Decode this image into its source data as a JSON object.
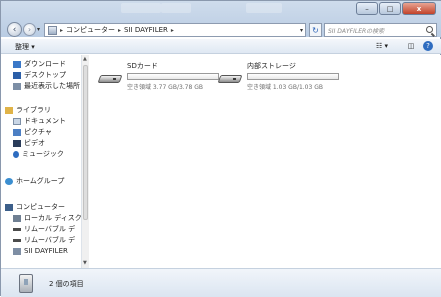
{
  "window": {
    "close_glyph": "x",
    "maximize_glyph": "□",
    "minimize_glyph": "–"
  },
  "address": {
    "crumbs": [
      "コンピューター",
      "SII DAYFILER"
    ],
    "separator": "▸",
    "dropdown": "▾"
  },
  "search": {
    "placeholder": "SII DAYFILERの検索"
  },
  "toolbar": {
    "organize_label": "整理 ▾",
    "view_label": "☷ ▾",
    "preview_label": "◫",
    "help_label": "?"
  },
  "nav": {
    "items": [
      {
        "label": "ダウンロード",
        "icon": "download-folder-icon",
        "color": "#3a78c8"
      },
      {
        "label": "デスクトップ",
        "icon": "desktop-icon",
        "color": "#2c5fa8"
      },
      {
        "label": "最近表示した場所",
        "icon": "recent-places-icon",
        "color": "#7d8fa6"
      },
      {
        "label": "ライブラリ",
        "icon": "library-icon",
        "color": "#e0b348"
      },
      {
        "label": "ドキュメント",
        "icon": "documents-icon",
        "color": "#c9d6e6"
      },
      {
        "label": "ピクチャ",
        "icon": "pictures-icon",
        "color": "#4c7fc4"
      },
      {
        "label": "ビデオ",
        "icon": "videos-icon",
        "color": "#2a3c5a"
      },
      {
        "label": "ミュージック",
        "icon": "music-icon",
        "color": "#2d6cc0"
      },
      {
        "label": "ホームグループ",
        "icon": "homegroup-icon",
        "color": "#3b8ed0"
      },
      {
        "label": "コンピューター",
        "icon": "computer-icon",
        "color": "#3d5f8a"
      },
      {
        "label": "ローカル ディスク",
        "icon": "local-disk-icon",
        "color": "#6f7f92"
      },
      {
        "label": "リムーバブル デ",
        "icon": "removable-disk-icon",
        "color": "#4b4b4b"
      },
      {
        "label": "リムーバブル デ",
        "icon": "removable-disk-icon",
        "color": "#4b4b4b"
      },
      {
        "label": "SII DAYFILER",
        "icon": "device-icon",
        "color": "#7e8ea4"
      }
    ]
  },
  "drives": [
    {
      "name": "SDカード",
      "space": "空き領域 3.77 GB/3.78 GB",
      "used_fraction": 0.003
    },
    {
      "name": "内部ストレージ",
      "space": "空き領域 1.03 GB/1.03 GB",
      "used_fraction": 0.0
    }
  ],
  "details": {
    "count_text": "2 個の項目"
  }
}
